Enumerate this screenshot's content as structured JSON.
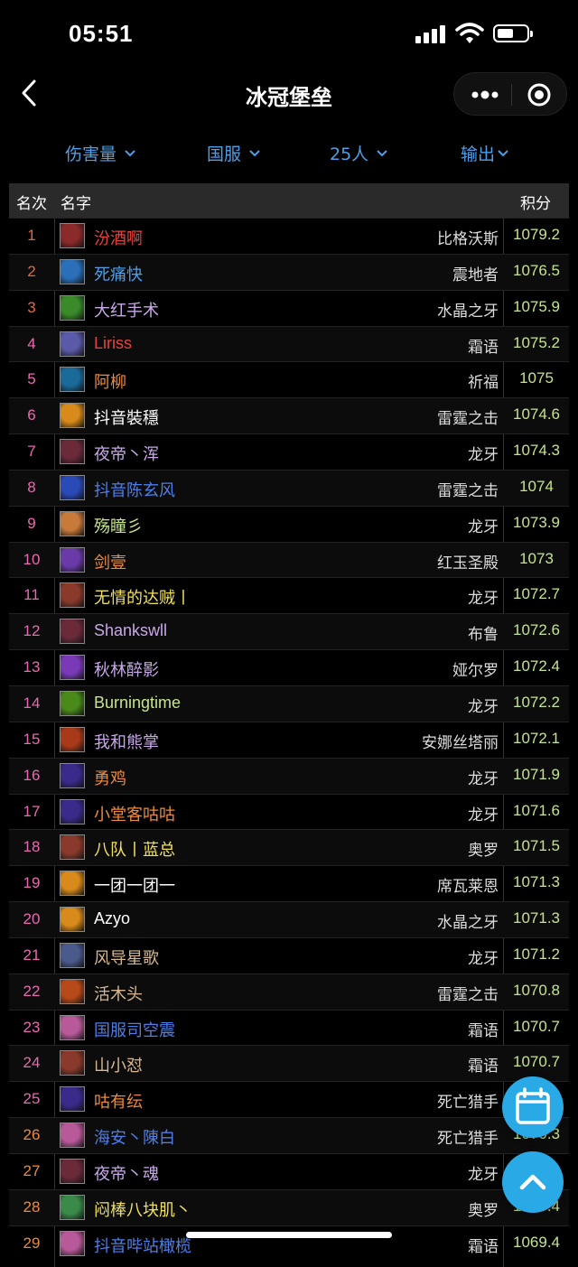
{
  "status": {
    "time": "05:51"
  },
  "nav": {
    "title": "冰冠堡垒"
  },
  "filters": [
    {
      "label": "伤害量"
    },
    {
      "label": "国服"
    },
    {
      "label": "25人"
    },
    {
      "label": "输出"
    }
  ],
  "table": {
    "headers": {
      "rank": "名次",
      "name": "名字",
      "score": "积分"
    },
    "rows": [
      {
        "rank": "1",
        "name": "汾酒啊",
        "server": "比格沃斯",
        "score": "1079.2",
        "name_color": "#e8433b",
        "rank_color": "#e8673b",
        "icon": "warrior-icon",
        "icon_color": "#8b2a2a"
      },
      {
        "rank": "2",
        "name": "死痛快",
        "server": "震地者",
        "score": "1076.5",
        "name_color": "#4d9fe8",
        "rank_color": "#e8673b",
        "icon": "frost-icon",
        "icon_color": "#2a6fb8"
      },
      {
        "rank": "3",
        "name": "大红手术",
        "server": "水晶之牙",
        "score": "1075.9",
        "name_color": "#c8a8e8",
        "rank_color": "#e8673b",
        "icon": "poison-icon",
        "icon_color": "#3a8a2a"
      },
      {
        "rank": "4",
        "name": "Liriss",
        "server": "霜语",
        "score": "1075.2",
        "name_color": "#e8433b",
        "rank_color": "#e86ab0",
        "icon": "ghost-icon",
        "icon_color": "#5a5aa8"
      },
      {
        "rank": "5",
        "name": "阿柳",
        "server": "祈福",
        "score": "1075",
        "name_color": "#f08a3b",
        "rank_color": "#e86ab0",
        "icon": "claw-icon",
        "icon_color": "#1a6a9a"
      },
      {
        "rank": "6",
        "name": "抖音裝穩",
        "server": "雷霆之击",
        "score": "1074.6",
        "name_color": "#ffffff",
        "rank_color": "#e86ab0",
        "icon": "skull-icon",
        "icon_color": "#d88a1a"
      },
      {
        "rank": "7",
        "name": "夜帝丶浑",
        "server": "龙牙",
        "score": "1074.3",
        "name_color": "#c8a8e8",
        "rank_color": "#e86ab0",
        "icon": "demon-icon",
        "icon_color": "#6a2a3a"
      },
      {
        "rank": "8",
        "name": "抖音陈玄风",
        "server": "雷霆之击",
        "score": "1074",
        "name_color": "#4d7fe8",
        "rank_color": "#e86ab0",
        "icon": "lightning-icon",
        "icon_color": "#2a4ab8"
      },
      {
        "rank": "9",
        "name": "殇瞳彡",
        "server": "龙牙",
        "score": "1073.9",
        "name_color": "#c6e48b",
        "rank_color": "#e86ab0",
        "icon": "fist-icon",
        "icon_color": "#c87a3a"
      },
      {
        "rank": "10",
        "name": "剑壹",
        "server": "红玉圣殿",
        "score": "1073",
        "name_color": "#f08a3b",
        "rank_color": "#e86ab0",
        "icon": "shadow-icon",
        "icon_color": "#6a3aa8"
      },
      {
        "rank": "11",
        "name": "无情的达贼丨",
        "server": "龙牙",
        "score": "1072.7",
        "name_color": "#f0e05a",
        "rank_color": "#e86ab0",
        "icon": "rogue-icon",
        "icon_color": "#8a3a2a"
      },
      {
        "rank": "12",
        "name": "Shankswll",
        "server": "布鲁",
        "score": "1072.6",
        "name_color": "#c8a8e8",
        "rank_color": "#e86ab0",
        "icon": "demon-icon",
        "icon_color": "#6a2a3a"
      },
      {
        "rank": "13",
        "name": "秋林醉影",
        "server": "娅尔罗",
        "score": "1072.4",
        "name_color": "#c8a8e8",
        "rank_color": "#e86ab0",
        "icon": "shadow-icon",
        "icon_color": "#7a3ab8"
      },
      {
        "rank": "14",
        "name": "Burningtime",
        "server": "龙牙",
        "score": "1072.2",
        "name_color": "#c6e48b",
        "rank_color": "#e86ab0",
        "icon": "nature-icon",
        "icon_color": "#4a8a1a"
      },
      {
        "rank": "15",
        "name": "我和熊掌",
        "server": "安娜丝塔丽",
        "score": "1072.1",
        "name_color": "#c8a8e8",
        "rank_color": "#e86ab0",
        "icon": "slash-icon",
        "icon_color": "#a83a1a"
      },
      {
        "rank": "16",
        "name": "勇鸡",
        "server": "龙牙",
        "score": "1071.9",
        "name_color": "#f08a3b",
        "rank_color": "#e86ab0",
        "icon": "star-icon",
        "icon_color": "#3a2a8a"
      },
      {
        "rank": "17",
        "name": "小堂客咕咕",
        "server": "龙牙",
        "score": "1071.6",
        "name_color": "#f08a3b",
        "rank_color": "#e86ab0",
        "icon": "star-icon",
        "icon_color": "#3a2a8a"
      },
      {
        "rank": "18",
        "name": "八队丨蓝总",
        "server": "奥罗",
        "score": "1071.5",
        "name_color": "#f0e05a",
        "rank_color": "#e86ab0",
        "icon": "rogue-icon",
        "icon_color": "#8a3a2a"
      },
      {
        "rank": "19",
        "name": "一团一团一",
        "server": "席瓦莱恩",
        "score": "1071.3",
        "name_color": "#ffffff",
        "rank_color": "#e86ab0",
        "icon": "skull-icon",
        "icon_color": "#d88a1a"
      },
      {
        "rank": "20",
        "name": "Azyo",
        "server": "水晶之牙",
        "score": "1071.3",
        "name_color": "#ffffff",
        "rank_color": "#e86ab0",
        "icon": "skull-icon",
        "icon_color": "#d88a1a"
      },
      {
        "rank": "21",
        "name": "风导星歌",
        "server": "龙牙",
        "score": "1071.2",
        "name_color": "#d8b890",
        "rank_color": "#e86ab0",
        "icon": "sword-icon",
        "icon_color": "#4a5a8a"
      },
      {
        "rank": "22",
        "name": "活木头",
        "server": "雷霆之击",
        "score": "1070.8",
        "name_color": "#d8b890",
        "rank_color": "#e86ab0",
        "icon": "flame-icon",
        "icon_color": "#b84a1a"
      },
      {
        "rank": "23",
        "name": "国服司空震",
        "server": "霜语",
        "score": "1070.7",
        "name_color": "#4d7fe8",
        "rank_color": "#e86ab0",
        "icon": "gnome-icon",
        "icon_color": "#b85a9a"
      },
      {
        "rank": "24",
        "name": "山小怼",
        "server": "霜语",
        "score": "1070.7",
        "name_color": "#d8b890",
        "rank_color": "#e86ab0",
        "icon": "rogue-icon",
        "icon_color": "#8a3a2a"
      },
      {
        "rank": "25",
        "name": "咕有纭",
        "server": "死亡猎手",
        "score": "",
        "name_color": "#f08a3b",
        "rank_color": "#e86ab0",
        "icon": "star-icon",
        "icon_color": "#3a2a8a"
      },
      {
        "rank": "26",
        "name": "海安丶陳白",
        "server": "死亡猎手",
        "score": "1070.3",
        "name_color": "#4d7fe8",
        "rank_color": "#f08a3b",
        "icon": "gnome-icon",
        "icon_color": "#b85a9a"
      },
      {
        "rank": "27",
        "name": "夜帝丶魂",
        "server": "龙牙",
        "score": "",
        "name_color": "#c8a8e8",
        "rank_color": "#f08a3b",
        "icon": "demon-icon",
        "icon_color": "#6a2a3a"
      },
      {
        "rank": "28",
        "name": "闷棒八块肌丶",
        "server": "奥罗",
        "score": "1070.4",
        "name_color": "#f0e05a",
        "rank_color": "#f08a3b",
        "icon": "blade-icon",
        "icon_color": "#3a8a4a"
      },
      {
        "rank": "29",
        "name": "抖音哔站橄榄",
        "server": "霜语",
        "score": "1069.4",
        "name_color": "#4d7fe8",
        "rank_color": "#f08a3b",
        "icon": "gnome-icon",
        "icon_color": "#b85a9a"
      }
    ]
  },
  "fab": {
    "calendar": "calendar-icon",
    "top": "scroll-top-icon",
    "color": "#29a9e6"
  }
}
